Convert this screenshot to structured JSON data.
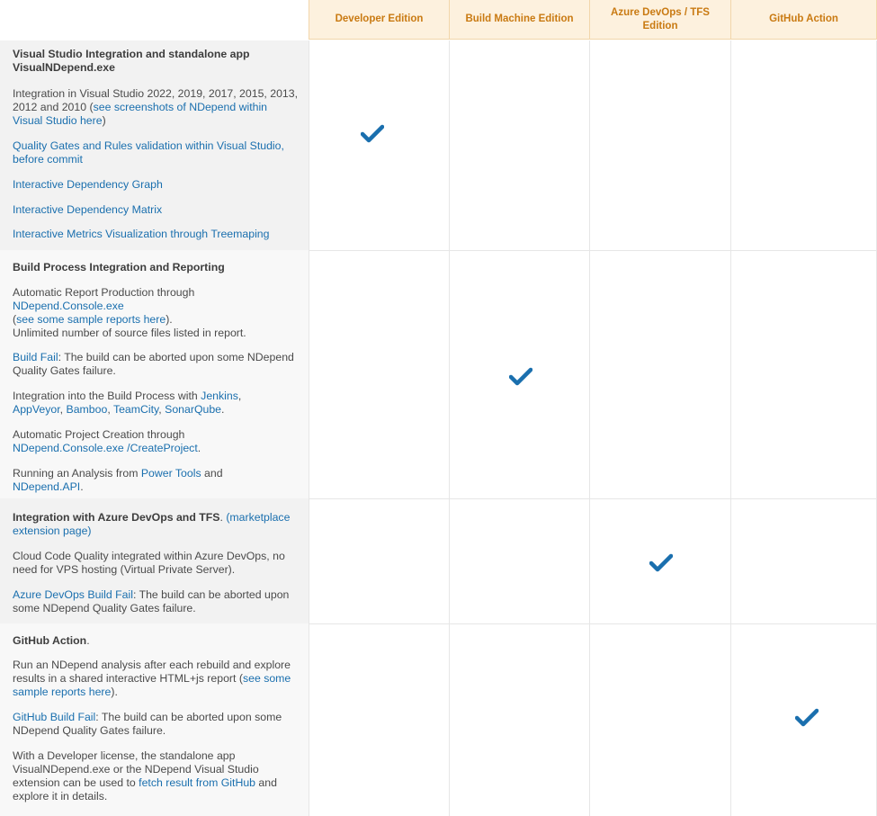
{
  "header": {
    "columns": [
      "Developer Edition",
      "Build Machine Edition",
      "Azure DevOps / TFS Edition",
      "GitHub Action"
    ]
  },
  "rows": [
    {
      "title": "Visual Studio Integration and standalone app VisualNDepend.exe",
      "p1_text": "Integration in Visual Studio 2022, 2019, 2017, 2015, 2013, 2012 and 2010 (",
      "p1_link": "see screenshots of NDepend within Visual Studio here",
      "p1_end": ")",
      "link1": "Quality Gates and Rules validation within Visual Studio, before commit",
      "link2": "Interactive Dependency Graph",
      "link3": "Interactive Dependency Matrix",
      "link4": "Interactive Metrics Visualization through Treemaping",
      "checked": "Developer Edition"
    },
    {
      "title": "Build Process Integration and Reporting",
      "p1_a": "Automatic Report Production through",
      "p1_link1": "NDepend.Console.exe",
      "p1_b": "(",
      "p1_link2": "see some sample reports here",
      "p1_c": ").",
      "p1_d": "Unlimited number of source files listed in report.",
      "p2_link": "Build Fail",
      "p2_text": ": The build can be aborted upon some NDepend Quality Gates failure.",
      "p3_text": "Integration into the Build Process with ",
      "p3_links": [
        "Jenkins",
        "AppVeyor",
        "Bamboo",
        "TeamCity",
        "SonarQube"
      ],
      "p4_text": "Automatic Project Creation through",
      "p4_link": "NDepend.Console.exe /CreateProject",
      "p5_text": "Running an Analysis from ",
      "p5_link1": "Power Tools",
      "p5_and": " and",
      "p5_link2": "NDepend.API",
      "checked": "Build Machine Edition"
    },
    {
      "title": "Integration with Azure DevOps and TFS",
      "title_link": "(marketplace extension page)",
      "p1": "Cloud Code Quality integrated within Azure DevOps, no need for VPS hosting (Virtual Private Server).",
      "p2_link": "Azure DevOps Build Fail",
      "p2_text": ": The build can be aborted upon some NDepend Quality Gates failure.",
      "checked": "Azure DevOps / TFS Edition"
    },
    {
      "title": "GitHub Action",
      "p1_text": "Run an NDepend analysis after each rebuild and explore results in a shared interactive HTML+js report (",
      "p1_link": "see some sample reports here",
      "p1_end": ").",
      "p2_link": "GitHub Build Fail",
      "p2_text": ": The build can be aborted upon some NDepend Quality Gates failure.",
      "p3_text": "With a Developer license, the standalone app VisualNDepend.exe or the NDepend Visual Studio extension can be used to ",
      "p3_link": "fetch result from GitHub",
      "p3_end": " and explore it in details.",
      "checked": "GitHub Action"
    }
  ],
  "colors": {
    "accent_link": "#1a6fae",
    "check": "#1a6fae",
    "header_bg": "#fdf1de",
    "header_text": "#c97a12"
  },
  "icons": {
    "check": "checkmark-icon"
  }
}
